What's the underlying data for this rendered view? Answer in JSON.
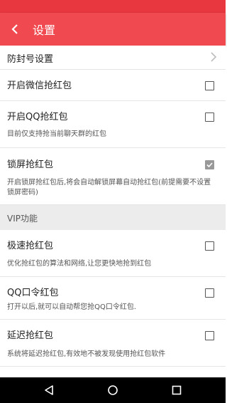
{
  "toolbar": {
    "title": "设置"
  },
  "rows": {
    "anti_ban": {
      "title": "防封号设置"
    },
    "wechat": {
      "title": "开启微信抢红包",
      "checked": false
    },
    "qq": {
      "title": "开启QQ抢红包",
      "desc": "目前仅支持抢当前聊天群的红包",
      "checked": false
    },
    "lockscreen": {
      "title": "锁屏抢红包",
      "desc": "开启锁屏抢红包后,将会自动解锁屏幕自动抢红包(前提需要不设置锁屏密码)",
      "checked": true
    },
    "fast": {
      "title": "极速抢红包",
      "desc": "优化抢红包的算法和网络,让您更快地抢到红包",
      "checked": false
    },
    "qq_password": {
      "title": "QQ口令红包",
      "desc": "打开以后,就可以自动帮您抢QQ口令红包.",
      "checked": false
    },
    "delay": {
      "title": "延迟抢红包",
      "desc": "系统将延迟抢红包,有效地不被发现使用抢红包软件",
      "checked": false
    }
  },
  "sections": {
    "vip": {
      "label": "VIP功能"
    }
  },
  "colors": {
    "accent": "#f04a50",
    "status_bar": "#e8373f",
    "checked": "#999999"
  }
}
